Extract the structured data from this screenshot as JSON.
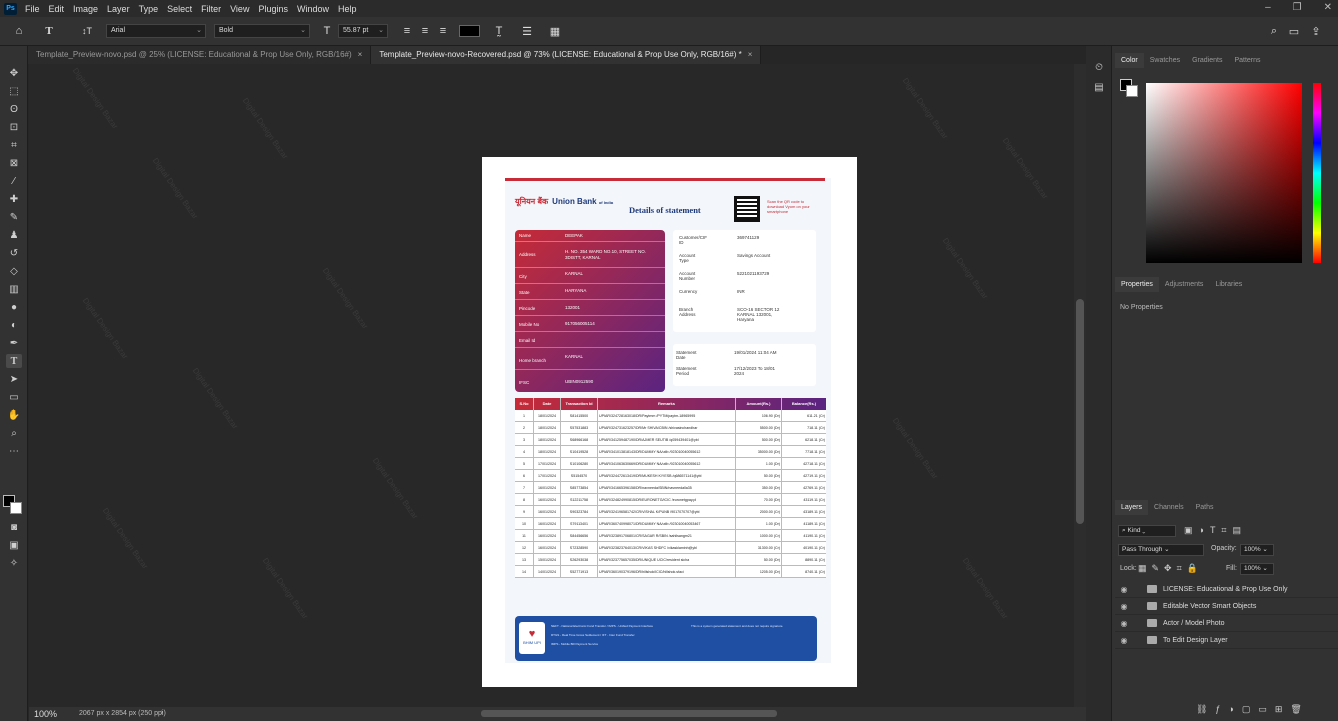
{
  "app": {
    "logo": "Ps",
    "menu": [
      "File",
      "Edit",
      "Image",
      "Layer",
      "Type",
      "Select",
      "Filter",
      "View",
      "Plugins",
      "Window",
      "Help"
    ]
  },
  "options": {
    "font_family": "Arial",
    "font_style": "Bold",
    "font_size": "55.87 pt",
    "swatch_color": "#000000"
  },
  "tabs": [
    {
      "label": "Template_Preview-novo.psd @ 25% (LICENSE: Educational & Prop Use Only, RGB/16#)",
      "close": "×"
    },
    {
      "label": "Template_Preview-novo-Recovered.psd @ 73% (LICENSE: Educational & Prop Use Only, RGB/16#) *",
      "close": "×"
    }
  ],
  "status": {
    "zoom": "100%",
    "doc_size": "2067 px x 2854 px (250 ppi)"
  },
  "watermark": "Digital Design Bazar",
  "statement": {
    "title": "Details of statement",
    "bank_hindi": "यूनियन बैंक",
    "bank_name": "Union Bank",
    "bank_sub": "of India",
    "qr_text": "Scan the QR code to download Vyom on your smartphone",
    "customer": [
      [
        "Name",
        "DEEPAK"
      ],
      [
        "Address",
        "H. NO. 354 WARD NO.10, STREET NO. 3DISTT, KARNAL"
      ],
      [
        "City",
        "KARNAL"
      ],
      [
        "State",
        "HARYANA"
      ],
      [
        "Pincode",
        "132001"
      ],
      [
        "Mobile No",
        "917056005114"
      ],
      [
        "Email Id",
        ""
      ],
      [
        "Home branch",
        "KARNAL"
      ],
      [
        "IFSC",
        "UBIN0912590"
      ]
    ],
    "account": [
      [
        "Customer/CIF ID",
        "369741129"
      ],
      [
        "Account Type",
        "Savings Account"
      ],
      [
        "Account Number",
        "5221021193729"
      ],
      [
        "Currency",
        "INR"
      ],
      [
        "Branch Address",
        "SCO-16 SECTOR 12 KARNAL 132001, Haryana"
      ]
    ],
    "period": [
      [
        "Statement Date",
        "19/01/2024 11:04 AM"
      ],
      [
        "Statement Period",
        "17/12/2023 To 18/01 2024"
      ]
    ],
    "columns": [
      "S.No",
      "Date",
      "Transaction Id",
      "Remarks",
      "Amount(Rs.)",
      "Balance(Rs.)"
    ],
    "rows": [
      [
        "1",
        "18/01/2024",
        "S81415500",
        "UPIAR/324728163018/DR/Paytmm /PYTM/paytm-18965995",
        "106.90 (Dr)",
        "611.21 (Cr)"
      ],
      [
        "2",
        "18/01/2024",
        "S57531883",
        "UPIAR/324731623257/DR/Mr SHIVA/CBIN /shivasinchandhar",
        "5500.00 (Dr)",
        "718.11 (Cr)"
      ],
      [
        "3",
        "18/01/2024",
        "S68966168",
        "UPIAR/341259487190/DR/AJMER SEUTIB /q059439401@ybl",
        "500.00 (Dr)",
        "6218.11 (Cr)"
      ],
      [
        "4",
        "18/01/2024",
        "S10419528",
        "UPIAR/341013818143/DR/DUMMY NA/utib /923010040055612",
        "35000.00 (Dr)",
        "7718.11 (Cr)"
      ],
      [
        "5",
        "17/01/2024",
        "S10106280",
        "UPIAR/341063630669/DR/DUMMY NA/utib /923010040055612",
        "1.00 (Dr)",
        "42718.11 (Cr)"
      ],
      [
        "6",
        "17/01/2024",
        "S5154570",
        "UPIAR/324472613419/DR/MUKESH K/YESB /q686571141@ybl",
        "50.00 (Dr)",
        "42719.11 (Cr)"
      ],
      [
        "7",
        "16/01/2024",
        "S85773854",
        "UPIAR/341665396158/DR/navneeda/SBIN/navneedalla35",
        "350.00 (Dr)",
        "42769.11 (Cr)"
      ],
      [
        "8",
        "16/01/2024",
        "S12211758",
        "UPIAR/324824990815/DR/EURONETG/ICIC /euronetgpay.pl",
        "70.00 (Dr)",
        "43119.11 (Cr)"
      ],
      [
        "9",
        "16/01/2024",
        "S90323784",
        "UPIAR/324196581742/CR/VISHAL K/PUNB /9017070707@ybl",
        "2000.00 (Cr)",
        "43189.11 (Cr)"
      ],
      [
        "10",
        "16/01/2024",
        "S79113401",
        "UPIAR/360740998071/DR/DUMMY NA/utib /923010040053467",
        "1.00 (Dr)",
        "41189.11 (Cr)"
      ],
      [
        "11",
        "16/01/2024",
        "S84456656",
        "UPIAR/323891706801/CR/SAGAR R/SBIN /sahilsangm21",
        "1000.00 (Cr)",
        "41190.11 (Cr)"
      ],
      [
        "12",
        "16/01/2024",
        "S72328590",
        "UPIAR/323823764013/CR/VIKAS SHDFC /vikasklaminh@ybl",
        "31300.00 (Cr)",
        "40190.11 (Cr)"
      ],
      [
        "13",
        "15/01/2024",
        "S26293038",
        "UPIAR/323775657035/DR/UNIQUE UCIC/resident sicha",
        "50.00 (Dr)",
        "8890.11 (Cr)"
      ],
      [
        "14",
        "14/01/2024",
        "S52771913",
        "UPIAR/360190379196/DR/hillshok/ICIC/hillshok.sfaci",
        "1205.00 (Dr)",
        "8740.11 (Cr)"
      ]
    ],
    "footer_logo": "BHIM UPI",
    "footer_notes": [
      "NEFT - National Electronic Fund Transfer / IMPS - Unified Payment Interface",
      "RTGS - Real Time Gross Settlement / IFT - Inter Fund Transfer",
      "IMPS - Mobile Bill Payment Service"
    ],
    "footer_right": "This is a system generated statement and does not require signature."
  },
  "panels": {
    "color_tabs": [
      "Color",
      "Swatches",
      "Gradients",
      "Patterns"
    ],
    "prop_tabs": [
      "Properties",
      "Adjustments",
      "Libraries"
    ],
    "no_props": "No Properties",
    "layer_tabs": [
      "Layers",
      "Channels",
      "Paths"
    ],
    "kind": "Kind",
    "blend": "Pass Through",
    "opacity_label": "Opacity:",
    "opacity": "100%",
    "lock_label": "Lock:",
    "fill_label": "Fill:",
    "fill": "100%",
    "layers": [
      "LICENSE: Educational & Prop Use Only",
      "Editable Vector Smart Objects",
      "Actor / Model Photo",
      "To Edit Design Layer"
    ],
    "foreground": "#000000",
    "background": "#ffffff"
  }
}
